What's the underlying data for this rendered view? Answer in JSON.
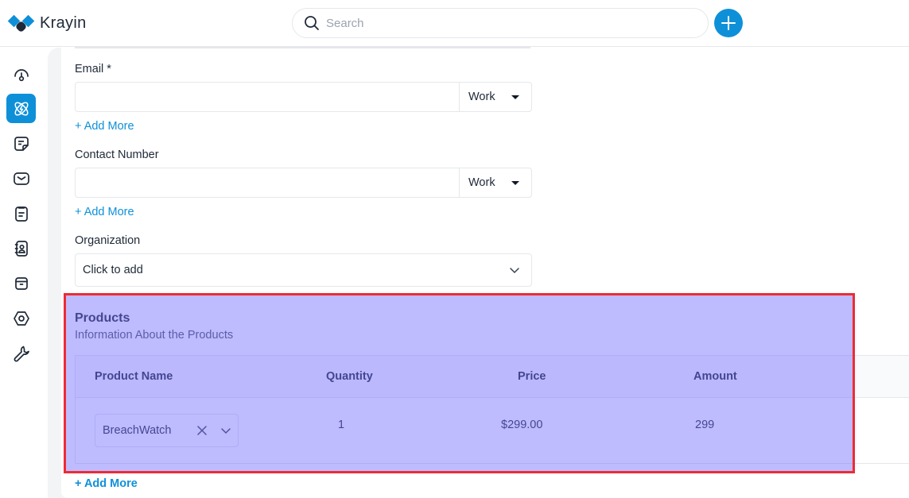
{
  "app": {
    "name": "Krayin",
    "brand_color": "#0e90d9",
    "highlight_color": "#ee2b33"
  },
  "header": {
    "search_placeholder": "Search",
    "search_icon": "search-icon",
    "add_button_icon": "plus-icon"
  },
  "sidebar": {
    "items": [
      {
        "name": "dashboard",
        "icon": "gauge-icon",
        "active": false
      },
      {
        "name": "leads",
        "icon": "atom-bolt-icon",
        "active": true
      },
      {
        "name": "quotes",
        "icon": "sticky-note-icon",
        "active": false
      },
      {
        "name": "mail",
        "icon": "mail-icon",
        "active": false
      },
      {
        "name": "activities",
        "icon": "clipboard-icon",
        "active": false
      },
      {
        "name": "contacts",
        "icon": "address-book-icon",
        "active": false
      },
      {
        "name": "products",
        "icon": "archive-box-icon",
        "active": false
      },
      {
        "name": "settings",
        "icon": "hex-nut-icon",
        "active": false
      },
      {
        "name": "configuration",
        "icon": "wrench-icon",
        "active": false
      }
    ]
  },
  "form": {
    "email": {
      "label": "Email *",
      "value": "",
      "type": "Work",
      "add_more": "+ Add More"
    },
    "contact_number": {
      "label": "Contact Number",
      "value": "",
      "type": "Work",
      "add_more": "+ Add More"
    },
    "organization": {
      "label": "Organization",
      "placeholder": "Click to add"
    }
  },
  "products": {
    "title": "Products",
    "subtitle": "Information About the Products",
    "columns": [
      "Product Name",
      "Quantity",
      "Price",
      "Amount"
    ],
    "rows": [
      {
        "product": "BreachWatch",
        "quantity": "1",
        "price": "$299.00",
        "amount": "299"
      }
    ],
    "add_more": "+ Add More"
  }
}
